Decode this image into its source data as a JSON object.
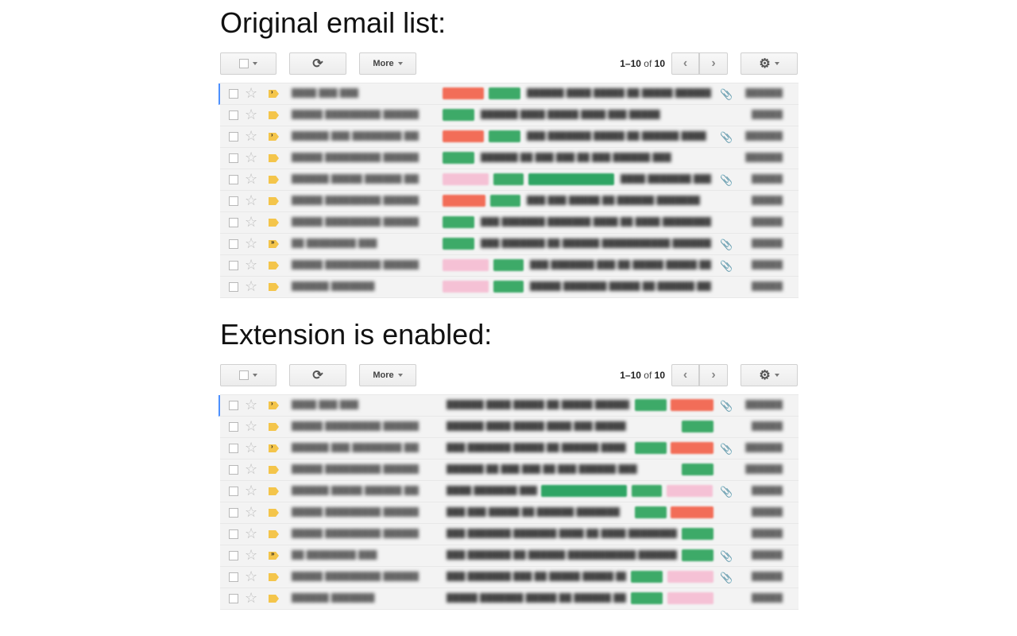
{
  "sections": [
    {
      "title": "Original email list:",
      "toolbar": {
        "more_label": "More",
        "pager_range": "1–10",
        "pager_of": "of",
        "pager_total": "10"
      }
    },
    {
      "title": "Extension is enabled:",
      "toolbar": {
        "more_label": "More",
        "pager_range": "1–10",
        "pager_of": "of",
        "pager_total": "10"
      }
    }
  ],
  "icons": {
    "refresh": "refresh-icon",
    "settings": "gear-icon",
    "star": "star-icon",
    "attachment": "paperclip-icon",
    "important": "importance-marker-icon"
  },
  "colors": {
    "label_red": "#f26d58",
    "label_green": "#3daa68",
    "label_pink": "#f5c1d5",
    "unread_marker": "#4d90fe",
    "importance": "#f4c54b"
  }
}
